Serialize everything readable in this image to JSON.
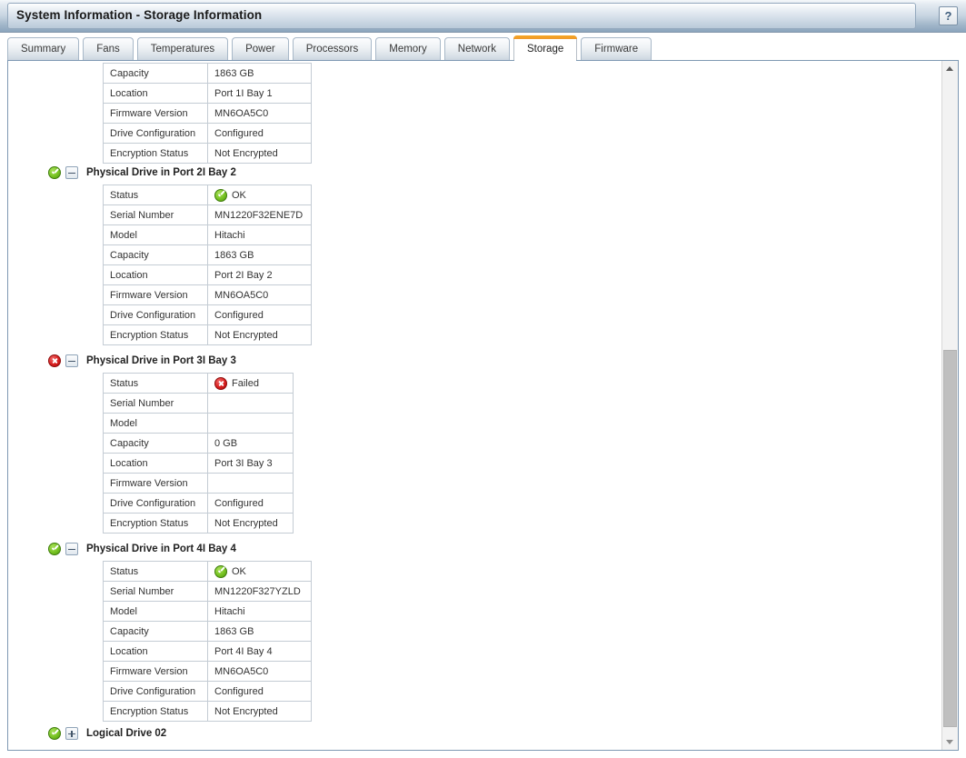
{
  "window": {
    "title": "System Information - Storage Information",
    "help_label": "?",
    "help_icon": "question-mark-icon"
  },
  "tabs": [
    {
      "label": "Summary",
      "active": false
    },
    {
      "label": "Fans",
      "active": false
    },
    {
      "label": "Temperatures",
      "active": false
    },
    {
      "label": "Power",
      "active": false
    },
    {
      "label": "Processors",
      "active": false
    },
    {
      "label": "Memory",
      "active": false
    },
    {
      "label": "Network",
      "active": false
    },
    {
      "label": "Storage",
      "active": true
    },
    {
      "label": "Firmware",
      "active": false
    }
  ],
  "colors": {
    "accent_active_tab": "#f5a623",
    "status_ok": "#77c322",
    "status_failed": "#d81f1f",
    "frame_border": "#7f99b3",
    "table_border": "#c4ccd4"
  },
  "scrollbar": {
    "up_arrow_icon": "chevron-up-icon",
    "down_arrow_icon": "chevron-down-icon"
  },
  "content": {
    "partial_table_top": {
      "rows": [
        {
          "key": "Capacity",
          "value": "1863 GB"
        },
        {
          "key": "Location",
          "value": "Port 1I Bay 1"
        },
        {
          "key": "Firmware Version",
          "value": "MN6OA5C0"
        },
        {
          "key": "Drive Configuration",
          "value": "Configured"
        },
        {
          "key": "Encryption Status",
          "value": "Not Encrypted"
        }
      ]
    },
    "drives": [
      {
        "header": "Physical Drive in Port 2I Bay 2",
        "status_icon": "status-ok-icon",
        "status": "ok",
        "expander": "-",
        "expanded": true,
        "rows": [
          {
            "key": "Status",
            "value": "OK",
            "value_icon": "status-ok-icon"
          },
          {
            "key": "Serial Number",
            "value": "MN1220F32ENE7D"
          },
          {
            "key": "Model",
            "value": "Hitachi"
          },
          {
            "key": "Capacity",
            "value": "1863 GB"
          },
          {
            "key": "Location",
            "value": "Port 2I Bay 2"
          },
          {
            "key": "Firmware Version",
            "value": "MN6OA5C0"
          },
          {
            "key": "Drive Configuration",
            "value": "Configured"
          },
          {
            "key": "Encryption Status",
            "value": "Not Encrypted"
          }
        ]
      },
      {
        "header": "Physical Drive in Port 3I Bay 3",
        "status_icon": "status-failed-icon",
        "status": "failed",
        "expander": "-",
        "expanded": true,
        "narrow": true,
        "rows": [
          {
            "key": "Status",
            "value": "Failed",
            "value_icon": "status-failed-icon"
          },
          {
            "key": "Serial Number",
            "value": ""
          },
          {
            "key": "Model",
            "value": ""
          },
          {
            "key": "Capacity",
            "value": "0 GB"
          },
          {
            "key": "Location",
            "value": "Port 3I Bay 3"
          },
          {
            "key": "Firmware Version",
            "value": ""
          },
          {
            "key": "Drive Configuration",
            "value": "Configured"
          },
          {
            "key": "Encryption Status",
            "value": "Not Encrypted"
          }
        ]
      },
      {
        "header": "Physical Drive in Port 4I Bay 4",
        "status_icon": "status-ok-icon",
        "status": "ok",
        "expander": "-",
        "expanded": true,
        "rows": [
          {
            "key": "Status",
            "value": "OK",
            "value_icon": "status-ok-icon"
          },
          {
            "key": "Serial Number",
            "value": "MN1220F327YZLD"
          },
          {
            "key": "Model",
            "value": "Hitachi"
          },
          {
            "key": "Capacity",
            "value": "1863 GB"
          },
          {
            "key": "Location",
            "value": "Port 4I Bay 4"
          },
          {
            "key": "Firmware Version",
            "value": "MN6OA5C0"
          },
          {
            "key": "Drive Configuration",
            "value": "Configured"
          },
          {
            "key": "Encryption Status",
            "value": "Not Encrypted"
          }
        ]
      }
    ],
    "logical_drive": {
      "header": "Logical Drive 02",
      "status_icon": "status-ok-icon",
      "status": "ok",
      "expander": "+",
      "expanded": false
    }
  }
}
